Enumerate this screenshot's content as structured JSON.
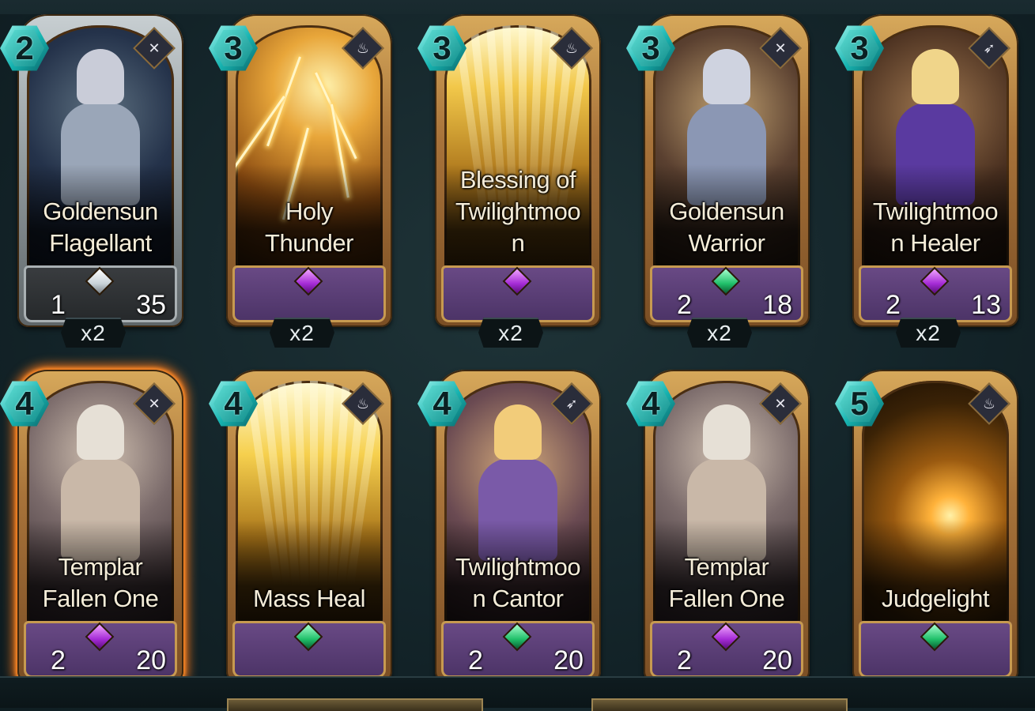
{
  "cards": [
    {
      "name": "Goldensun\nFlagellant",
      "cost": "2",
      "atk": "1",
      "hp": "35",
      "gem": "white",
      "count": "x2",
      "type_icon": "crossed-swords-icon",
      "art": "hero-1",
      "frame": "silver"
    },
    {
      "name": "Holy\nThunder",
      "cost": "3",
      "atk": "",
      "hp": "",
      "gem": "purple",
      "count": "x2",
      "type_icon": "spell-icon",
      "art": "lightning",
      "frame": "gold"
    },
    {
      "name": "Blessing of\nTwilightmoo\nn",
      "cost": "3",
      "atk": "",
      "hp": "",
      "gem": "purple",
      "count": "x2",
      "type_icon": "spell-icon",
      "art": "rays",
      "frame": "gold"
    },
    {
      "name": "Goldensun\nWarrior",
      "cost": "3",
      "atk": "2",
      "hp": "18",
      "gem": "green",
      "count": "x2",
      "type_icon": "crossed-swords-icon",
      "art": "hero-2",
      "frame": "gold"
    },
    {
      "name": "Twilightmoo\nn Healer",
      "cost": "3",
      "atk": "2",
      "hp": "13",
      "gem": "purple",
      "count": "x2",
      "type_icon": "bow-icon",
      "art": "hero-3",
      "frame": "gold"
    },
    {
      "name": "Templar\nFallen One",
      "cost": "4",
      "atk": "2",
      "hp": "20",
      "gem": "purple",
      "count": "",
      "type_icon": "crossed-swords-icon",
      "art": "templar",
      "frame": "fiery"
    },
    {
      "name": "Mass Heal",
      "cost": "4",
      "atk": "",
      "hp": "",
      "gem": "green",
      "count": "",
      "type_icon": "spell-icon",
      "art": "rays2",
      "frame": "gold"
    },
    {
      "name": "Twilightmoo\nn Cantor",
      "cost": "4",
      "atk": "2",
      "hp": "20",
      "gem": "green",
      "count": "",
      "type_icon": "bow-icon",
      "art": "hero-4",
      "frame": "gold"
    },
    {
      "name": "Templar\nFallen One",
      "cost": "4",
      "atk": "2",
      "hp": "20",
      "gem": "purple",
      "count": "",
      "type_icon": "crossed-swords-icon",
      "art": "templar",
      "frame": "gold"
    },
    {
      "name": "Judgelight",
      "cost": "5",
      "atk": "",
      "hp": "",
      "gem": "green",
      "count": "",
      "type_icon": "spell-icon",
      "art": "fireball",
      "frame": "gold"
    }
  ],
  "colors": {
    "cost_gem": "#17b3b0",
    "frame_gold": "#c89a52",
    "plate_purple": "#5a3e78"
  }
}
